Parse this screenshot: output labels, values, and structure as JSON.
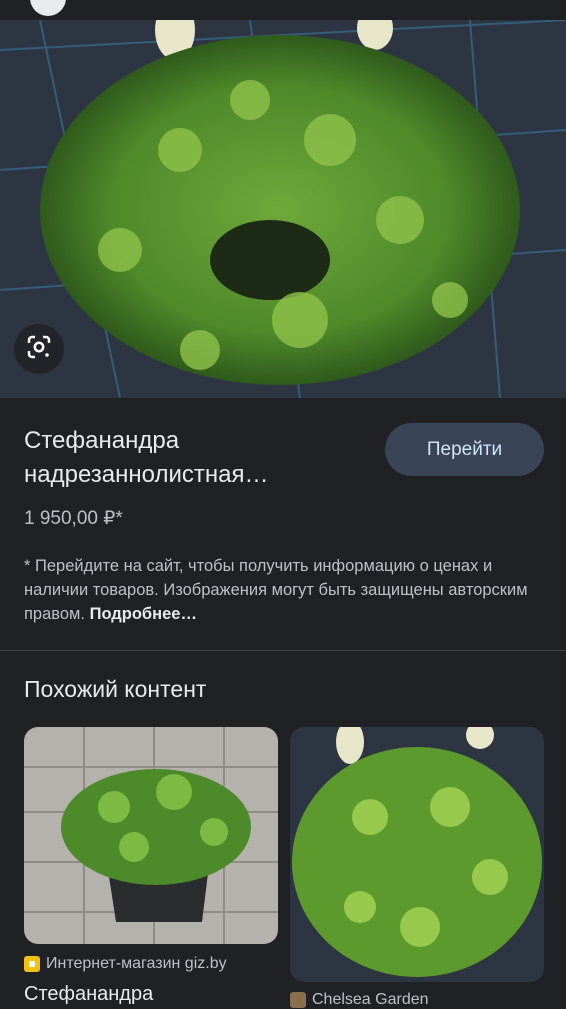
{
  "product": {
    "title": "Стефанандра надрезаннолистная…",
    "go_button": "Перейти",
    "price": "1 950,00 ₽*",
    "disclaimer": "* Перейдите на сайт, чтобы получить информацию о ценах и наличии товаров. Изображения могут быть защищены авторским правом.",
    "more_link": "Подробнее…"
  },
  "similar": {
    "heading": "Похожий контент",
    "cards": [
      {
        "source": "Интернет-магазин giz.by",
        "title": "Стефанандра"
      },
      {
        "source": "Chelsea Garden",
        "title": ""
      }
    ]
  },
  "icons": {
    "lens": "lens-icon",
    "source1": "giz-favicon-icon",
    "source2": "chelsea-favicon-icon"
  },
  "colors": {
    "background": "#202124",
    "button": "#394457",
    "button_text": "#d2e3fc"
  }
}
